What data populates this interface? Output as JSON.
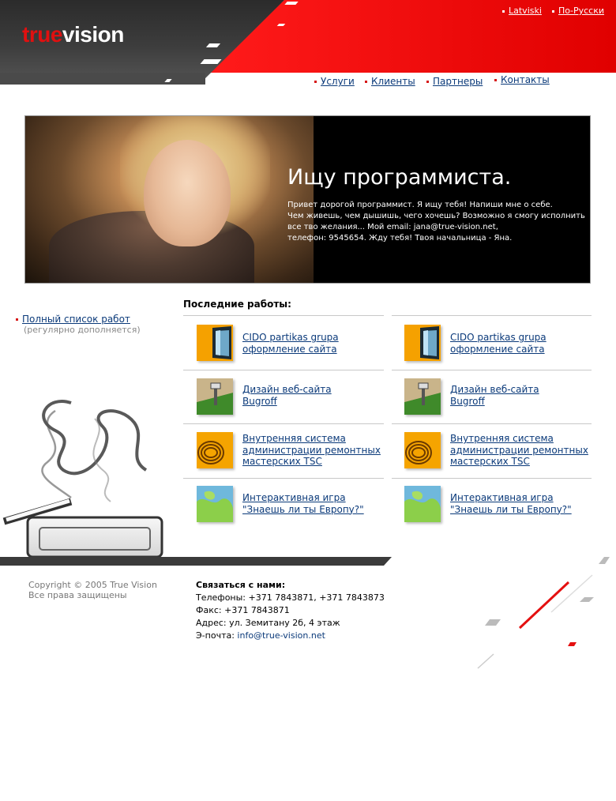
{
  "brand": {
    "logo_part1": "true",
    "logo_part2": "vision"
  },
  "languages": [
    {
      "label": "Latviski"
    },
    {
      "label": "По-Русски"
    }
  ],
  "nav": [
    {
      "label": "Услуги"
    },
    {
      "label": "Клиенты"
    },
    {
      "label": "Партнеры"
    },
    {
      "label": "Контакты"
    }
  ],
  "hero": {
    "title": "Ищу программиста.",
    "lines": [
      "Привет дорогой программист. Я ищу тебя! Напиши мне о себе.",
      "Чем живешь, чем дышишь, чего хочешь? Возможно я смогу исполнить",
      "все тво желания... Мой email: jana@true-vision.net,",
      "телефон: 9545654. Жду тебя! Твоя начальница - Яна."
    ]
  },
  "sidebar": {
    "all_works_link": "Полный список работ",
    "all_works_note": "(регулярно дополняется)"
  },
  "works": {
    "title": "Последние работы:",
    "items": [
      {
        "line1": "CIDO partikas grupa",
        "line2": "оформление сайта",
        "line3": "",
        "icon": "tv-screen-icon",
        "color": "#f5a100"
      },
      {
        "line1": "Дизайн веб-сайта",
        "line2": "Bugroff",
        "line3": "",
        "icon": "garden-lamp-icon",
        "color": "#7a6a4a"
      },
      {
        "line1": "Внутренняя система",
        "line2": "администрации ремонтных",
        "line3": "мастерских TSC",
        "icon": "cable-coil-icon",
        "color": "#f0a010"
      },
      {
        "line1": "Интерактивная игра",
        "line2": "\"Знаешь ли ты Европу?\"",
        "line3": "",
        "icon": "europe-map-icon",
        "color": "#58a8d0"
      }
    ]
  },
  "footer": {
    "copyright1": "Copyright © 2005 True Vision",
    "copyright2": "Все права защищены",
    "contact_head": "Связаться с нами:",
    "phones": "Телефоны: +371 7843871, +371 7843873",
    "fax": "Факс: +371 7843871",
    "address": "Адрес: ул. Земитану 2б, 4 этаж",
    "email_label": "Э-почта: ",
    "email": "info@true-vision.net"
  }
}
